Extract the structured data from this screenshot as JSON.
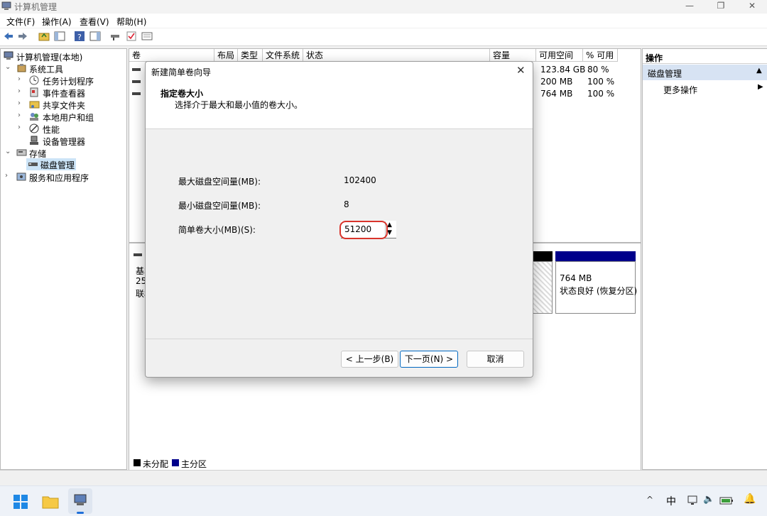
{
  "window": {
    "title": "计算机管理",
    "controls": [
      "—",
      "❐",
      "✕"
    ]
  },
  "menu": [
    "文件(F)",
    "操作(A)",
    "查看(V)",
    "帮助(H)"
  ],
  "tree": {
    "root": "计算机管理(本地)",
    "system_tools": "系统工具",
    "task_scheduler": "任务计划程序",
    "event_viewer": "事件查看器",
    "shared_folders": "共享文件夹",
    "local_users": "本地用户和组",
    "performance": "性能",
    "device_manager": "设备管理器",
    "storage": "存储",
    "disk_management": "磁盘管理",
    "services_apps": "服务和应用程序"
  },
  "volume_table": {
    "headers": [
      "卷",
      "布局",
      "类型",
      "文件系统",
      "状态",
      "容量",
      "可用空间",
      "% 可用"
    ],
    "rows": [
      {
        "free": "123.84 GB",
        "pct": "80 %"
      },
      {
        "free": "200 MB",
        "pct": "100 %"
      },
      {
        "free": "764 MB",
        "pct": "100 %"
      }
    ]
  },
  "disk_view": {
    "left_text": [
      "基本",
      "25",
      "联机"
    ],
    "partition_size": "764 MB",
    "partition_status": "状态良好 (恢复分区)"
  },
  "legend": {
    "unallocated": "未分配",
    "primary": "主分区"
  },
  "actions": {
    "header": "操作",
    "section": "磁盘管理",
    "more": "更多操作"
  },
  "dialog": {
    "title": "新建简单卷向导",
    "heading": "指定卷大小",
    "subheading": "选择介于最大和最小值的卷大小。",
    "max_label": "最大磁盘空间量(MB):",
    "max_value": "102400",
    "min_label": "最小磁盘空间量(MB):",
    "min_value": "8",
    "size_label": "简单卷大小(MB)(S):",
    "size_value": "51200",
    "back": "< 上一步(B)",
    "next": "下一页(N) >",
    "cancel": "取消"
  },
  "taskbar": {
    "ime": "中"
  },
  "colors": {
    "primary_partition": "#00008b",
    "unallocated": "#000000",
    "highlight": "#d9342b",
    "selection": "#cce4f7"
  }
}
